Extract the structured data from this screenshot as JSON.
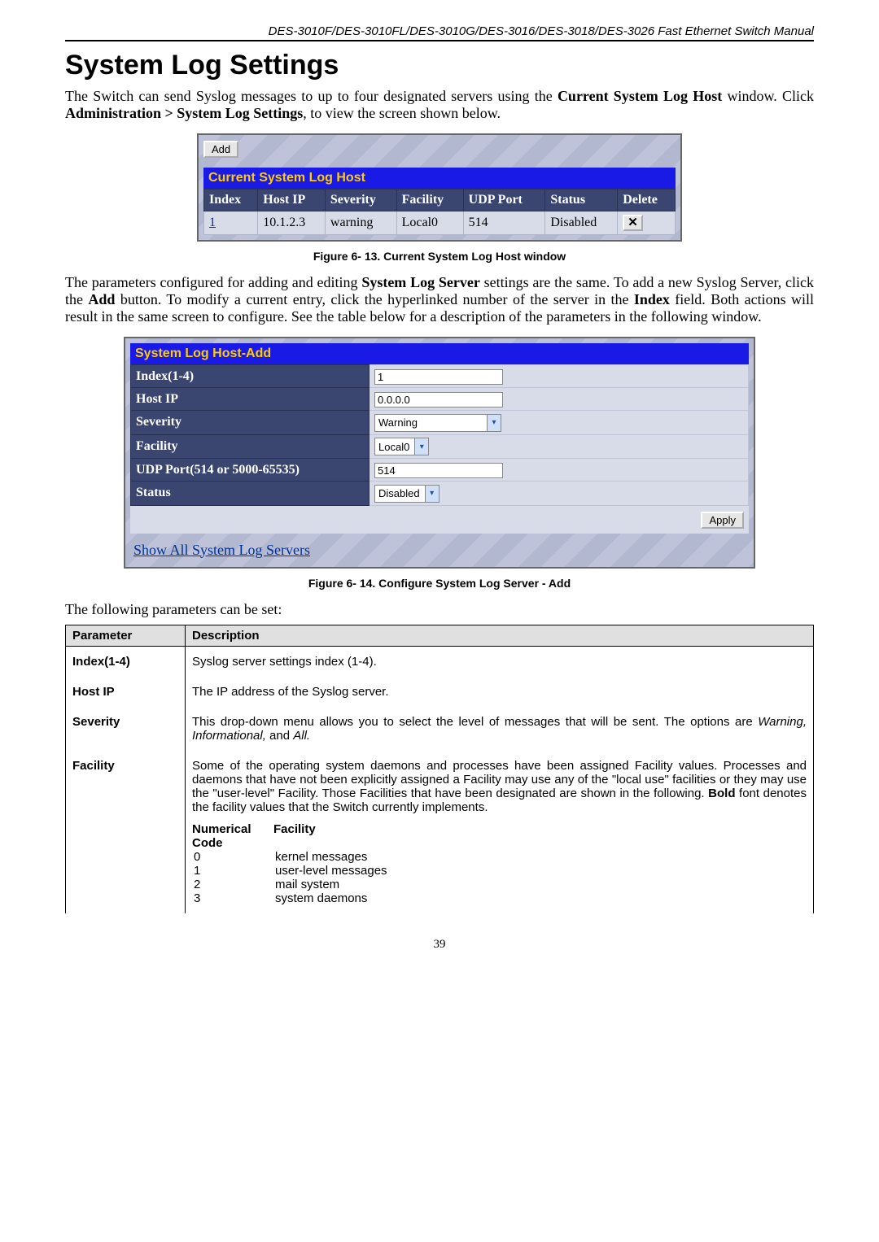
{
  "header": "DES-3010F/DES-3010FL/DES-3010G/DES-3016/DES-3018/DES-3026 Fast Ethernet Switch Manual",
  "title": "System Log Settings",
  "intro_part1": "The Switch can send Syslog messages to up to four designated servers using the ",
  "intro_bold1": "Current System Log Host",
  "intro_part2": " window. Click ",
  "intro_bold2": "Administration > System Log Settings",
  "intro_part3": ", to view the screen shown below.",
  "panel1": {
    "add_button": "Add",
    "section_title": "Current System Log Host",
    "columns": [
      "Index",
      "Host IP",
      "Severity",
      "Facility",
      "UDP Port",
      "Status",
      "Delete"
    ],
    "row": {
      "index": "1",
      "host_ip": "10.1.2.3",
      "severity": "warning",
      "facility": "Local0",
      "udp_port": "514",
      "status": "Disabled"
    }
  },
  "caption1": "Figure 6- 13.  Current System Log Host window",
  "para2_a": "The parameters configured for adding and editing ",
  "para2_b": "System Log Server",
  "para2_c": " settings are the same. To add a new Syslog Server, click the ",
  "para2_d": "Add",
  "para2_e": " button. To modify a current entry, click the hyperlinked number of the server in the ",
  "para2_f": "Index",
  "para2_g": " field. Both actions will result in the same screen to configure. See the table below for a description of the parameters in the following window.",
  "panel2": {
    "section_title": "System Log Host-Add",
    "labels": {
      "index": "Index(1-4)",
      "host_ip": "Host IP",
      "severity": "Severity",
      "facility": "Facility",
      "udp_port": "UDP Port(514 or 5000-65535)",
      "status": "Status"
    },
    "values": {
      "index": "1",
      "host_ip": "0.0.0.0",
      "severity": "Warning",
      "facility": "Local0",
      "udp_port": "514",
      "status": "Disabled"
    },
    "apply_button": "Apply",
    "show_all_link": "Show All System Log Servers"
  },
  "caption2": "Figure 6- 14.  Configure System Log Server - Add",
  "para3": "The following parameters can be set:",
  "paramtable": {
    "head_param": "Parameter",
    "head_desc": "Description",
    "rows": [
      {
        "name": "Index(1-4)",
        "desc": "Syslog server settings index (1-4)."
      },
      {
        "name": "Host IP",
        "desc": "The IP address of the Syslog server."
      },
      {
        "name": "Severity",
        "desc": "This drop-down menu allows you to select the level of messages that will be sent. The options are ",
        "desc_italic": "Warning, Informational,",
        "desc_after": " and ",
        "desc_italic2": "All."
      }
    ],
    "facility": {
      "name": "Facility",
      "desc_a": "Some of the operating system daemons and processes have been assigned Facility values. Processes and daemons that have not been explicitly assigned a Facility may use any of the \"local use\" facilities or they may use the \"user-level\" Facility. Those Facilities that have been designated are shown in the following. ",
      "desc_bold": "Bold",
      "desc_b": " font denotes the facility values that the Switch currently implements.",
      "sub_num": "Numerical Code",
      "sub_fac": "Facility",
      "codes": [
        {
          "n": "0",
          "f": "kernel messages"
        },
        {
          "n": "1",
          "f": "user-level messages"
        },
        {
          "n": "2",
          "f": "mail system"
        },
        {
          "n": "3",
          "f": "system daemons"
        }
      ]
    }
  },
  "page_number": "39"
}
